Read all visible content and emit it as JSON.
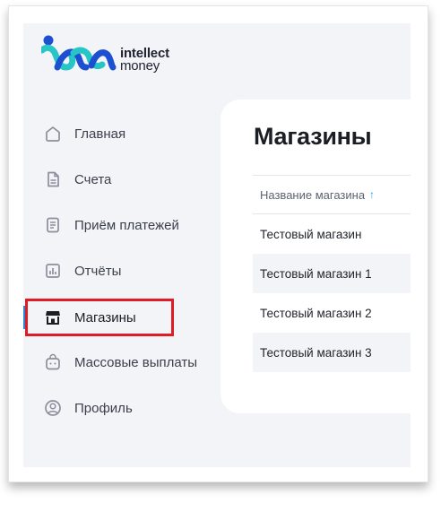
{
  "logo": {
    "line1": "intellect",
    "line2": "money"
  },
  "sidebar": {
    "items": [
      {
        "label": "Главная",
        "icon": "home-icon"
      },
      {
        "label": "Счета",
        "icon": "document-icon"
      },
      {
        "label": "Приём платежей",
        "icon": "payment-receipt-icon"
      },
      {
        "label": "Отчёты",
        "icon": "report-chart-icon"
      },
      {
        "label": "Магазины",
        "icon": "store-icon",
        "active": true
      },
      {
        "label": "Массовые выплаты",
        "icon": "bag-icon"
      },
      {
        "label": "Профиль",
        "icon": "profile-icon"
      }
    ]
  },
  "main": {
    "title": "Магазины",
    "table": {
      "header": "Название магазина",
      "sort_indicator": "↑",
      "rows": [
        "Тестовый магазин",
        "Тестовый магазин 1",
        "Тестовый магазин 2",
        "Тестовый магазин 3"
      ]
    }
  },
  "colors": {
    "accent": "#1f8bd6",
    "highlight": "#e01b24",
    "background": "#f3f4f8",
    "logo_blue": "#1d4fd1",
    "logo_teal": "#27c5c6"
  }
}
